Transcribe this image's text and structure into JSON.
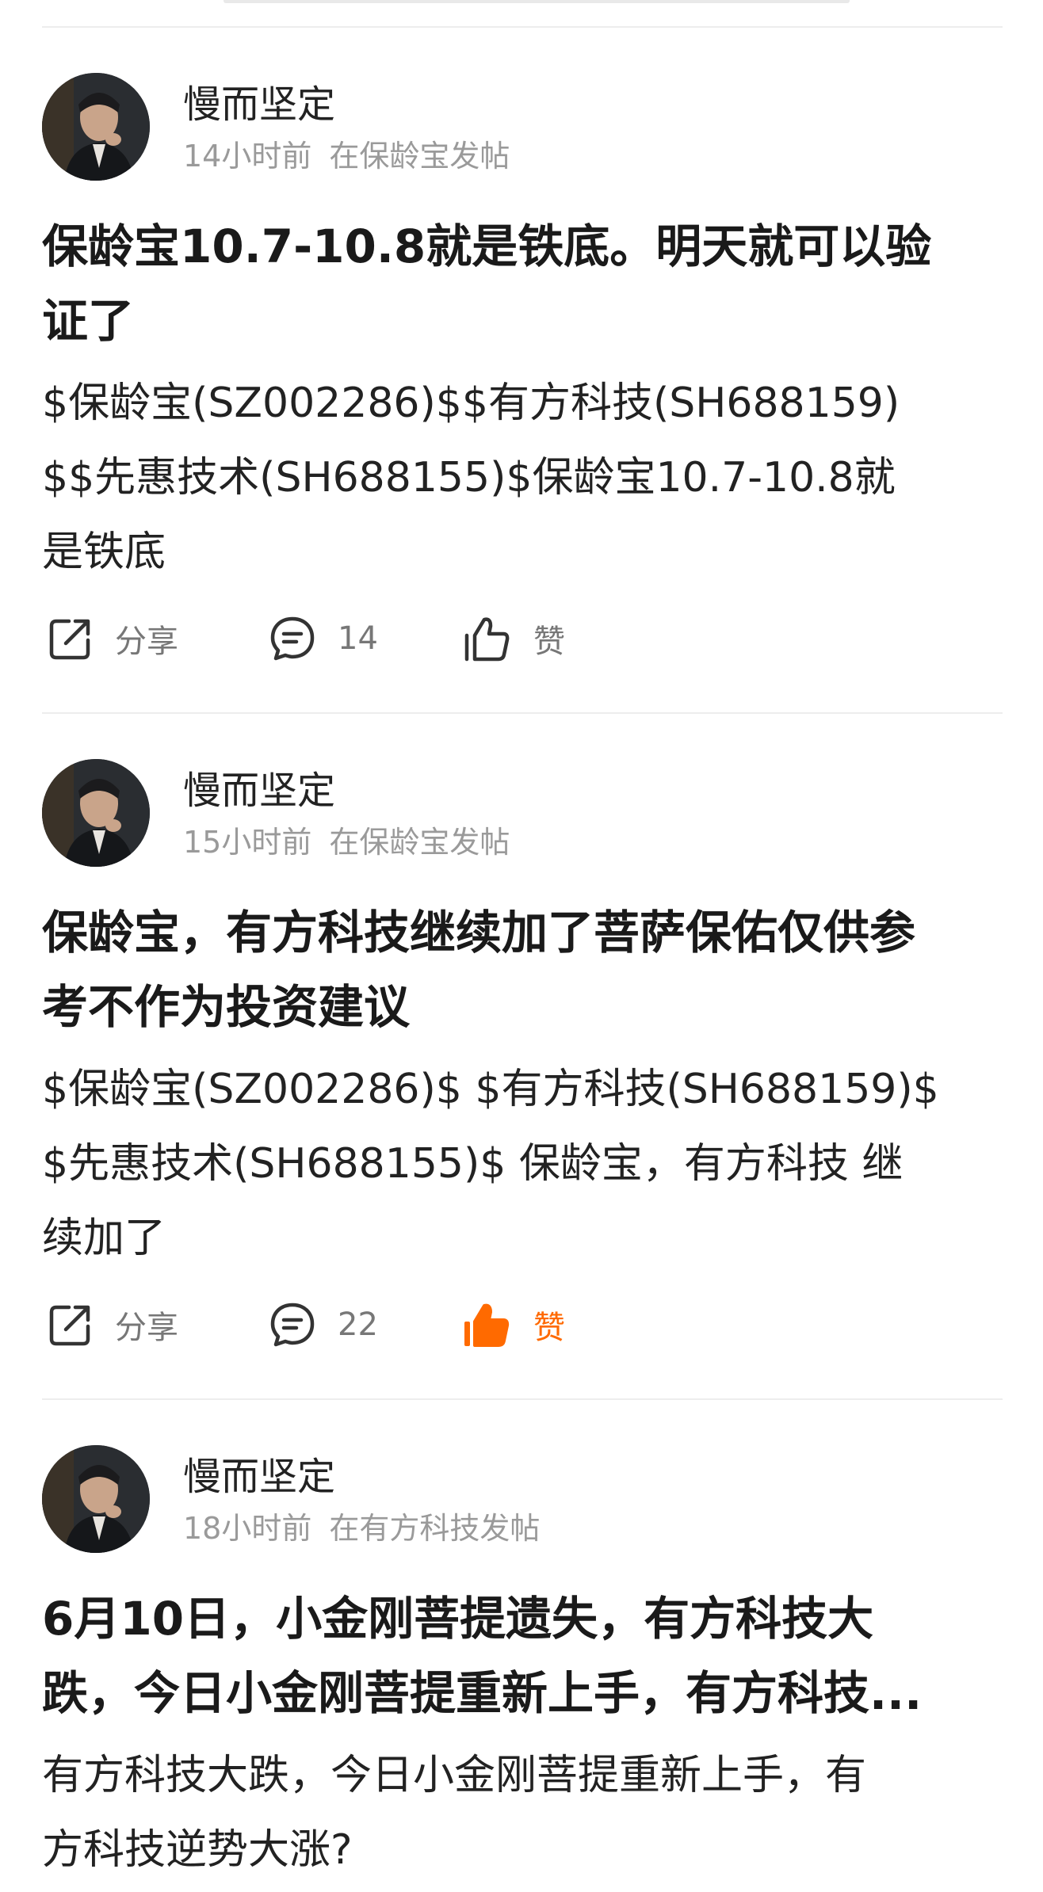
{
  "posts": [
    {
      "author": "慢而坚定",
      "time": "14小时前",
      "location": "在保龄宝发帖",
      "title": "保龄宝10.7-10.8就是铁底。明天就可以验\n证了",
      "body": "$保龄宝(SZ002286)$$有方科技(SH688159)\n$$先惠技术(SH688155)$保龄宝10.7-10.8就\n是铁底",
      "share_label": "分享",
      "comment_count": "14",
      "like_label": "赞",
      "liked": false
    },
    {
      "author": "慢而坚定",
      "time": "15小时前",
      "location": "在保龄宝发帖",
      "title": "保龄宝，有方科技继续加了菩萨保佑仅供参\n考不作为投资建议",
      "body": "$保龄宝(SZ002286)$ $有方科技(SH688159)$\n$先惠技术(SH688155)$ 保龄宝，有方科技 继\n续加了",
      "share_label": "分享",
      "comment_count": "22",
      "like_label": "赞",
      "liked": true
    },
    {
      "author": "慢而坚定",
      "time": "18小时前",
      "location": "在有方科技发帖",
      "title": "6月10日，小金刚菩提遗失，有方科技大\n跌，今日小金刚菩提重新上手，有方科技...",
      "body": "有方科技大跌，今日小金刚菩提重新上手，有\n方科技逆势大涨?"
    }
  ],
  "colors": {
    "accent": "#ff6a00",
    "meta_gray": "#9a9a9a",
    "icon_gray": "#333333",
    "divider": "#ededed"
  },
  "icons": {
    "share": "share-icon",
    "comment": "comment-icon",
    "like": "thumbs-up-icon"
  }
}
